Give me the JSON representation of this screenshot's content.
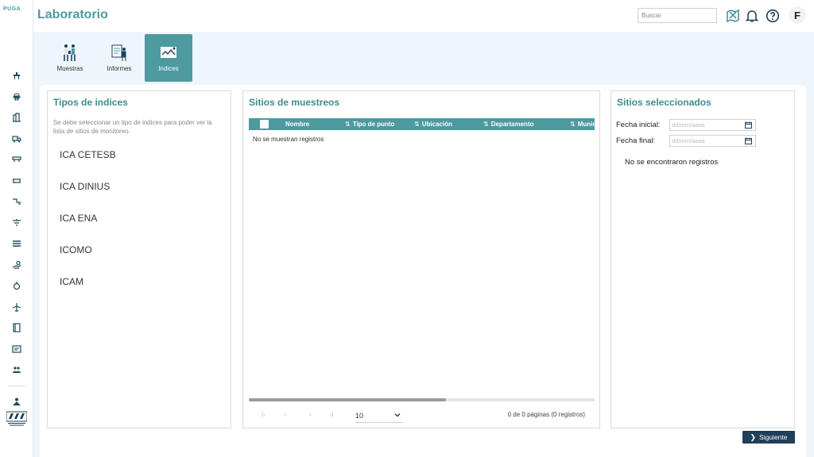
{
  "brand": {
    "logo_text": "PUGA"
  },
  "header": {
    "title": "Laboratorio",
    "search_placeholder": "Buscar",
    "avatar_initial": "F"
  },
  "tabs": [
    {
      "label": "Muestras",
      "active": false
    },
    {
      "label": "Informes",
      "active": false
    },
    {
      "label": "Indices",
      "active": true
    }
  ],
  "sidebar": {
    "icons": [
      "water-tap-icon",
      "bell-station-icon",
      "building-icon",
      "truck-icon",
      "sewer-icon",
      "pipe-icon",
      "flow-icon",
      "filter-icon",
      "layers-icon",
      "gear-hand-icon",
      "apple-icon",
      "plane-icon",
      "book-icon",
      "document-icon",
      "group-icon",
      "person-icon"
    ]
  },
  "tipos": {
    "title": "Tipos de indices",
    "help": "Se debe seleccionar un tipo de indices para poder ver la lista de sitios de monitoreo.",
    "items": [
      "ICA CETESB",
      "ICA DINIUS",
      "ICA ENA",
      "ICOMO",
      "ICAM"
    ]
  },
  "sitios": {
    "title": "Sitios de muestreos",
    "columns": [
      "Nombre",
      "Tipo de punto",
      "Ubicación",
      "Departamento",
      "Municipio"
    ],
    "empty": "No se muestran registros",
    "page_size": "10",
    "pager_info": "0 de 0 páginas (0 registros)"
  },
  "seleccionados": {
    "title": "Sitios seleccionados",
    "fecha_inicial_label": "Fecha inicial:",
    "fecha_final_label": "Fecha final:",
    "date_placeholder": "dd/mm/aaaa",
    "empty": "No se encontraron registros"
  },
  "actions": {
    "next_label": "Siguiente"
  },
  "colors": {
    "accent": "#4d9aa0",
    "dark": "#1f3f5a",
    "background": "#eef5fb"
  }
}
